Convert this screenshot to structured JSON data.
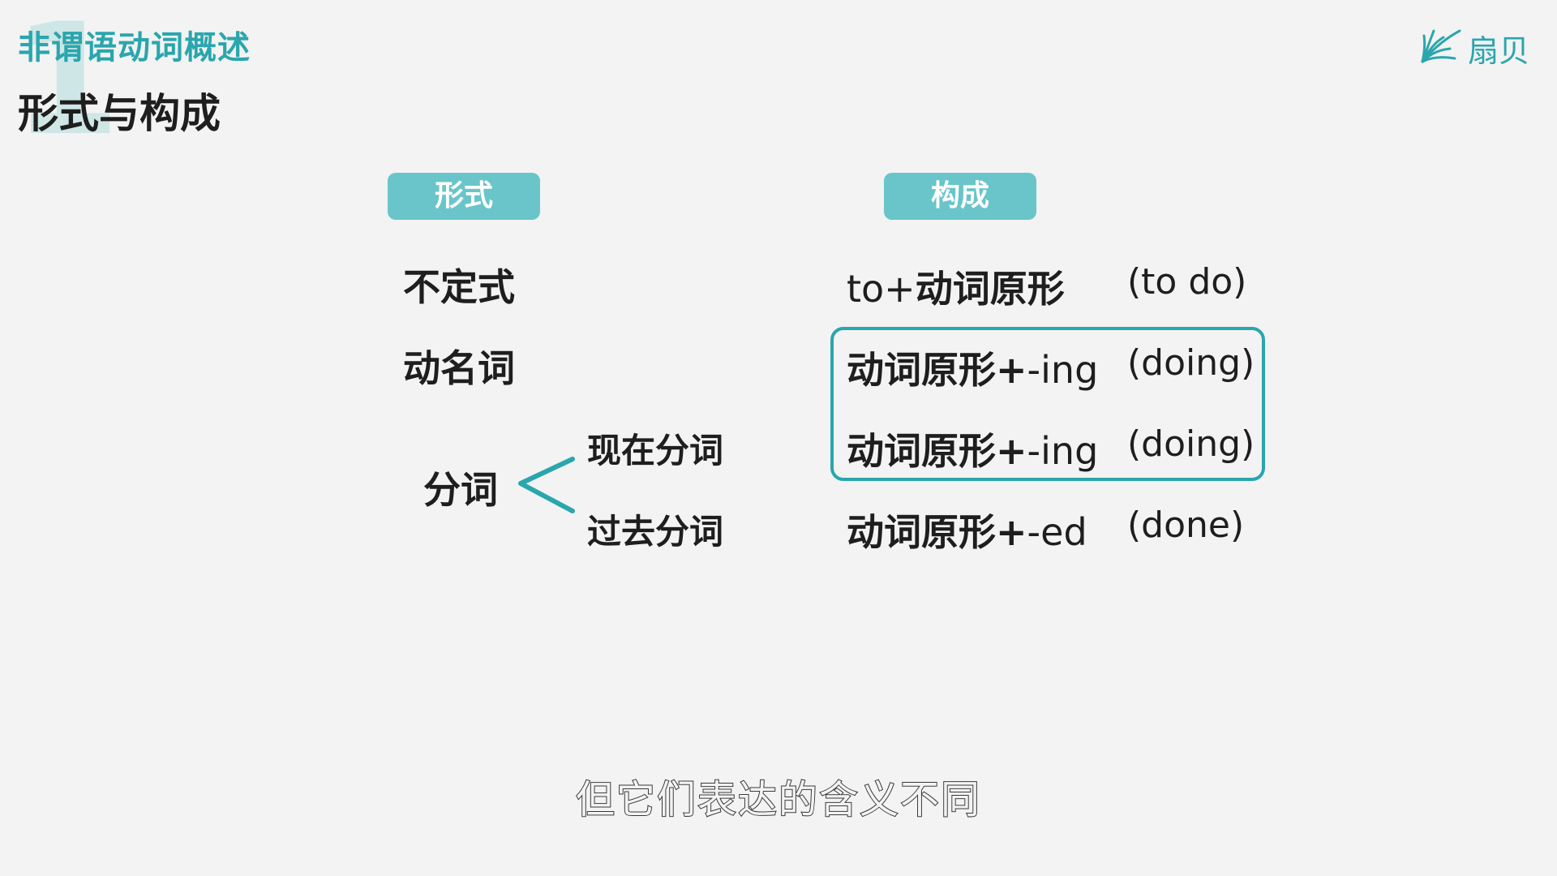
{
  "header": {
    "section_number": "1",
    "section_title": "非谓语动词概述",
    "page_title": "形式与构成"
  },
  "logo": {
    "text": "扇贝",
    "icon": "shanbay-leaf-icon",
    "color": "#2aa6ad"
  },
  "columns": {
    "form_label": "形式",
    "composition_label": "构成"
  },
  "forms": [
    {
      "label": "不定式"
    },
    {
      "label": "动名词"
    },
    {
      "label": "分词",
      "sub": [
        "现在分词",
        "过去分词"
      ]
    }
  ],
  "compositions": [
    {
      "prefix": "to+",
      "base": "动词原形",
      "suffix": "",
      "example": "(to do)"
    },
    {
      "prefix": "",
      "base": "动词原形+",
      "suffix": "-ing",
      "example": "(doing)"
    },
    {
      "prefix": "",
      "base": "动词原形+",
      "suffix": "-ing",
      "example": "(doing)"
    },
    {
      "prefix": "",
      "base": "动词原形+",
      "suffix": "-ed",
      "example": "(done)"
    }
  ],
  "subtitle": "但它们表达的含义不同",
  "colors": {
    "accent": "#2aa6ad",
    "pill": "#69c5c9",
    "background": "#f3f3f3"
  }
}
